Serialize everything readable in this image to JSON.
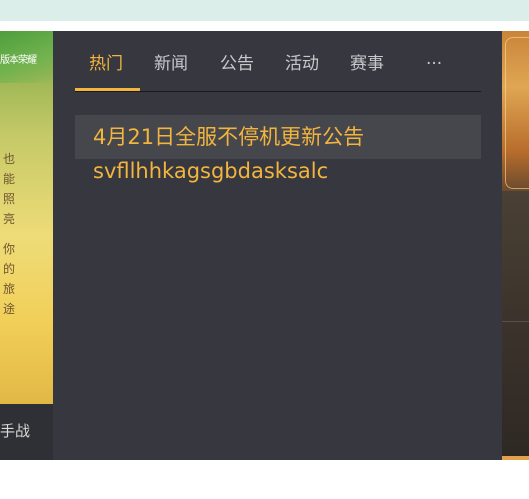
{
  "left_panel": {
    "art_badge": "版本荣耀",
    "art_text_col1": "也\n能\n照\n亮",
    "art_text_col2": "你\n的\n旅\n途",
    "label": "手战"
  },
  "tabs": [
    {
      "label": "热门",
      "active": true
    },
    {
      "label": "新闻",
      "active": false
    },
    {
      "label": "公告",
      "active": false
    },
    {
      "label": "活动",
      "active": false
    },
    {
      "label": "赛事",
      "active": false
    },
    {
      "label": "...",
      "active": false
    }
  ],
  "news": [
    {
      "title": "4月21日全服不停机更新公告"
    },
    {
      "title": "svfllhhkagsgbdasksalc"
    }
  ],
  "colors": {
    "accent": "#f2b53e",
    "panel_bg": "#37373f",
    "highlight_bg": "#46464d"
  }
}
